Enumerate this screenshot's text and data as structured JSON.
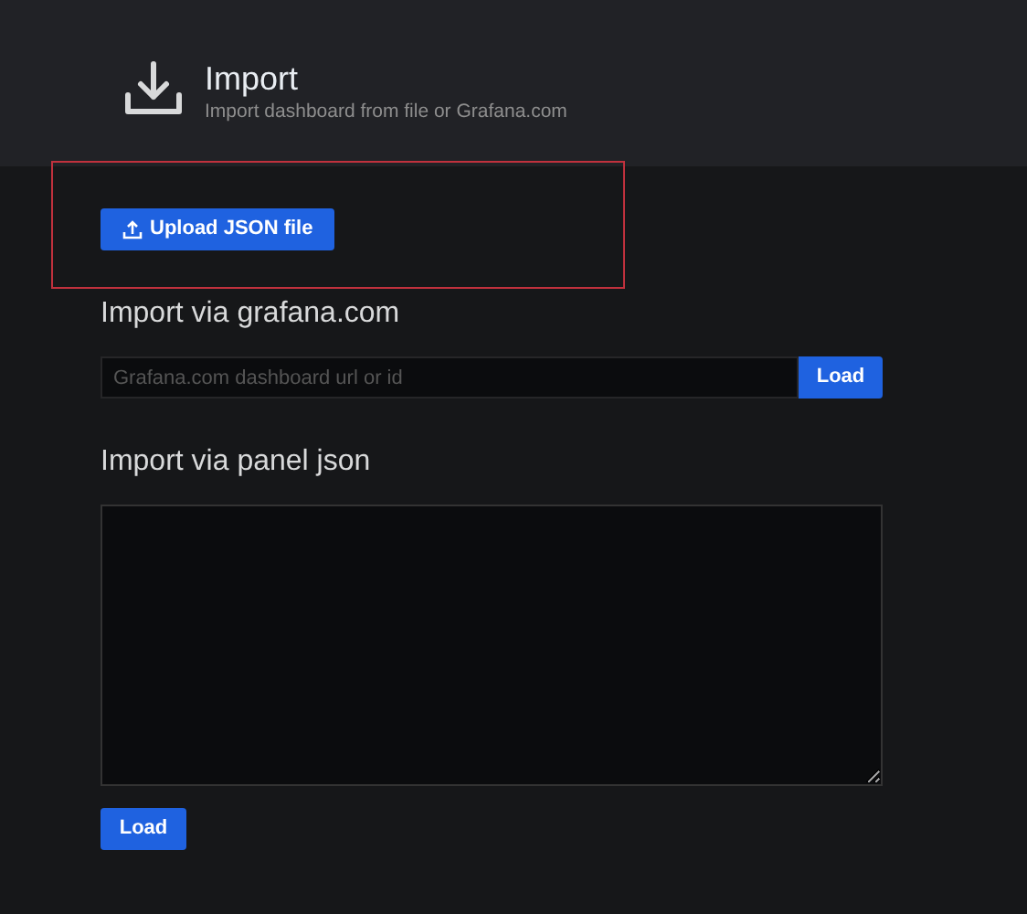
{
  "header": {
    "title": "Import",
    "subtitle": "Import dashboard from file or Grafana.com"
  },
  "upload_button": "Upload JSON file",
  "grafana_section": {
    "heading": "Import via grafana.com",
    "placeholder": "Grafana.com dashboard url or id",
    "button": "Load"
  },
  "panel_section": {
    "heading": "Import via panel json",
    "button": "Load"
  }
}
